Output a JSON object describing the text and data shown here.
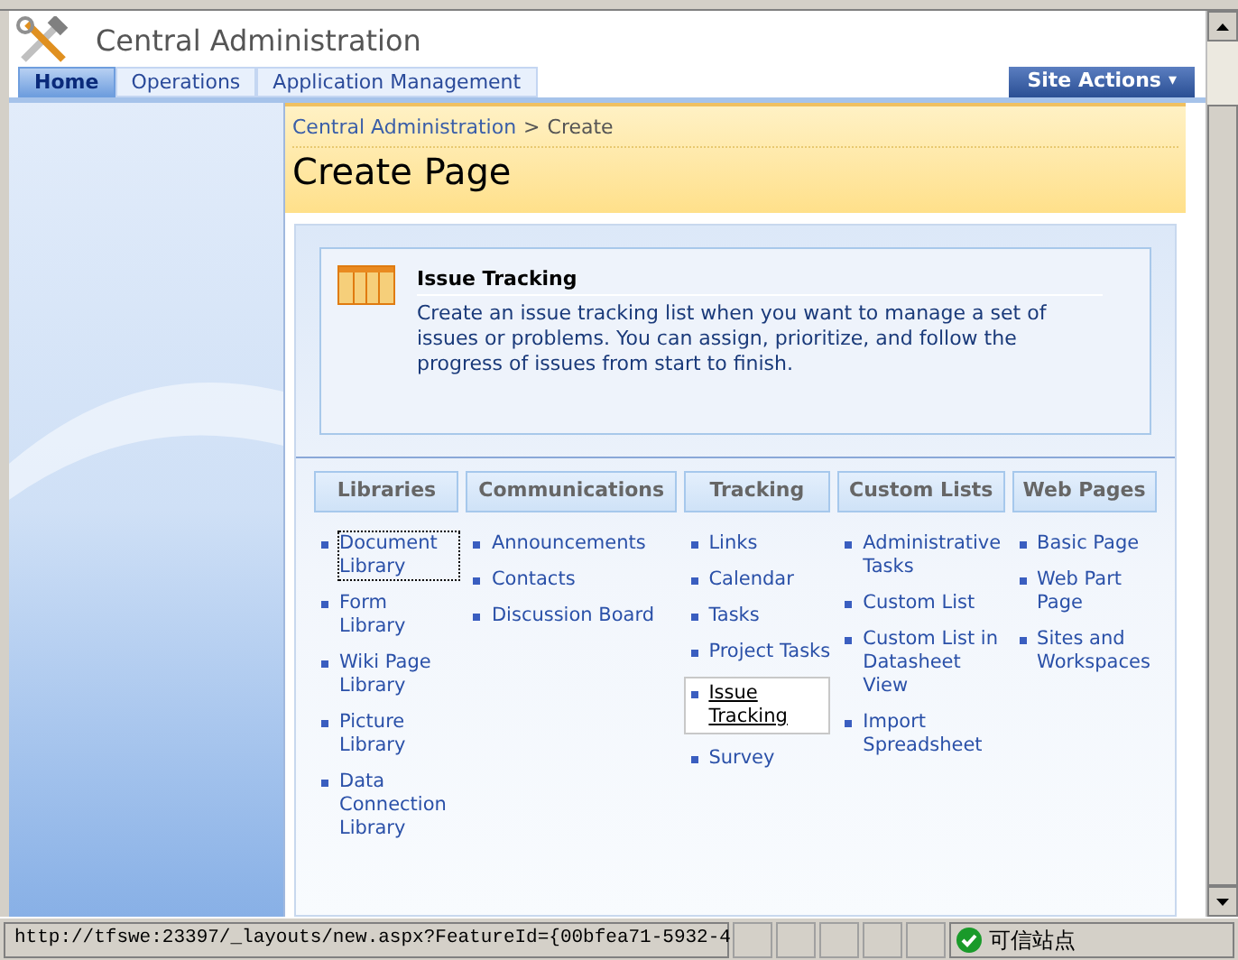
{
  "header": {
    "title": "Central Administration"
  },
  "tabs": [
    {
      "label": "Home",
      "selected": true
    },
    {
      "label": "Operations",
      "selected": false
    },
    {
      "label": "Application Management",
      "selected": false
    }
  ],
  "site_actions": {
    "label": "Site Actions",
    "caret": "▾"
  },
  "breadcrumb": {
    "link": "Central Administration",
    "separator": ">",
    "current": "Create"
  },
  "page_title": "Create Page",
  "description": {
    "title": "Issue Tracking",
    "text": "Create an issue tracking list when you want to manage a set of issues or problems. You can assign, prioritize, and follow the progress of issues from start to finish."
  },
  "categories": [
    {
      "heading": "Libraries",
      "items": [
        {
          "label": "Document Library",
          "selected": false,
          "focused": true
        },
        {
          "label": "Form Library",
          "selected": false,
          "focused": false
        },
        {
          "label": "Wiki Page Library",
          "selected": false,
          "focused": false
        },
        {
          "label": "Picture Library",
          "selected": false,
          "focused": false
        },
        {
          "label": "Data Connection Library",
          "selected": false,
          "focused": false
        }
      ]
    },
    {
      "heading": "Communications",
      "items": [
        {
          "label": "Announcements",
          "selected": false,
          "focused": false
        },
        {
          "label": "Contacts",
          "selected": false,
          "focused": false
        },
        {
          "label": "Discussion Board",
          "selected": false,
          "focused": false
        }
      ]
    },
    {
      "heading": "Tracking",
      "items": [
        {
          "label": "Links",
          "selected": false,
          "focused": false
        },
        {
          "label": "Calendar",
          "selected": false,
          "focused": false
        },
        {
          "label": "Tasks",
          "selected": false,
          "focused": false
        },
        {
          "label": "Project Tasks",
          "selected": false,
          "focused": false
        },
        {
          "label": "Issue Tracking",
          "selected": true,
          "focused": false
        },
        {
          "label": "Survey",
          "selected": false,
          "focused": false
        }
      ]
    },
    {
      "heading": "Custom Lists",
      "items": [
        {
          "label": "Administrative Tasks",
          "selected": false,
          "focused": false
        },
        {
          "label": "Custom List",
          "selected": false,
          "focused": false
        },
        {
          "label": "Custom List in Datasheet View",
          "selected": false,
          "focused": false
        },
        {
          "label": "Import Spreadsheet",
          "selected": false,
          "focused": false
        }
      ]
    },
    {
      "heading": "Web Pages",
      "items": [
        {
          "label": "Basic Page",
          "selected": false,
          "focused": false
        },
        {
          "label": "Web Part Page",
          "selected": false,
          "focused": false
        },
        {
          "label": "Sites and Workspaces",
          "selected": false,
          "focused": false
        }
      ]
    }
  ],
  "status_bar": {
    "url": "http://tfswe:23397/_layouts/new.aspx?FeatureId={00bfea71-5932-4",
    "zone": "可信站点"
  }
}
